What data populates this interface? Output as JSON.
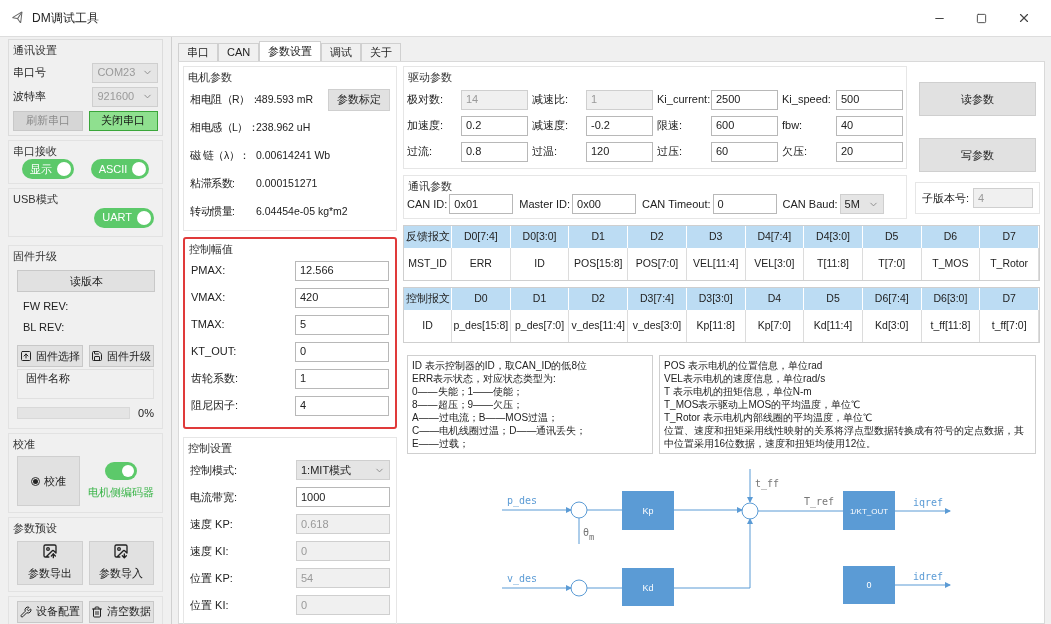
{
  "window": {
    "title": "DM调试工具"
  },
  "sidebar": {
    "comm": {
      "title": "通讯设置",
      "port_label": "串口号",
      "port": {
        "value": "COM23",
        "disabled": true
      },
      "baud_label": "波特率",
      "baud": {
        "value": "921600",
        "disabled": true
      },
      "buttons": [
        {
          "label": "刷新串口",
          "disabled": true,
          "active": false
        },
        {
          "label": "关闭串口",
          "disabled": false,
          "active": true
        }
      ]
    },
    "receive": {
      "title": "串口接收",
      "toggles": [
        {
          "label": "显示",
          "on": true
        },
        {
          "label": "ASCII",
          "on": true
        }
      ]
    },
    "usb": {
      "title": "USB模式",
      "toggles": [
        {
          "label": "UART",
          "on": true
        }
      ]
    },
    "firmware": {
      "title": "固件升级",
      "read_button": "读版本",
      "revisions": [
        "FW REV:",
        "BL REV:"
      ],
      "buttons": [
        {
          "label": "固件选择",
          "kind": "upload"
        },
        {
          "label": "固件升级",
          "kind": "save"
        }
      ],
      "name_label": "固件名称",
      "progress": {
        "level": 0,
        "reading": "0%"
      }
    },
    "calibrate": {
      "title": "校准",
      "radio": {
        "label": "校准",
        "selected": true
      },
      "toggle": {
        "label": "电机侧编码器",
        "on": true
      }
    },
    "presets": {
      "title": "参数预设",
      "buttons": [
        {
          "label": "参数导出",
          "kind": "export"
        },
        {
          "label": "参数导入",
          "kind": "import"
        }
      ]
    },
    "footer_buttons": [
      {
        "label": "设备配置",
        "kind": "tools"
      },
      {
        "label": "清空数据",
        "kind": "trash"
      }
    ]
  },
  "tabs": [
    {
      "label": "串口",
      "selected": false
    },
    {
      "label": "CAN",
      "selected": false
    },
    {
      "label": "参数设置",
      "selected": true
    },
    {
      "label": "调试",
      "selected": false
    },
    {
      "label": "关于",
      "selected": false
    }
  ],
  "motor": {
    "title": "电机参数",
    "calibrate_button": "参数标定",
    "rows": [
      {
        "label": "相电阻（R）：",
        "value": "489.593 mR"
      },
      {
        "label": "相电感（L）：",
        "value": "238.962 uH"
      },
      {
        "label": "磁 链（λ）：",
        "value": "0.00614241 Wb"
      },
      {
        "label": "粘滞系数:",
        "value": "0.000151271"
      },
      {
        "label": "转动惯量:",
        "value": "6.04454e-05 kg*m2"
      }
    ]
  },
  "limits": {
    "title": "控制幅值",
    "highlighted": true,
    "rows": [
      {
        "label": "PMAX:",
        "value": "12.566"
      },
      {
        "label": "VMAX:",
        "value": "420"
      },
      {
        "label": "TMAX:",
        "value": "5"
      },
      {
        "label": "KT_OUT:",
        "value": "0"
      },
      {
        "label": "齿轮系数:",
        "value": "1"
      },
      {
        "label": "阻尼因子:",
        "value": "4"
      }
    ]
  },
  "control": {
    "title": "控制设置",
    "rows": [
      {
        "label": "控制模式:",
        "value": "1:MIT模式",
        "kind": "select",
        "disabled": false
      },
      {
        "label": "电流带宽:",
        "value": "1000",
        "kind": "input",
        "disabled": false
      },
      {
        "label": "速度 KP:",
        "value": "0.618",
        "kind": "input",
        "disabled": true
      },
      {
        "label": "速度 KI:",
        "value": "0",
        "kind": "input",
        "disabled": true
      },
      {
        "label": "位置 KP:",
        "value": "54",
        "kind": "input",
        "disabled": true
      },
      {
        "label": "位置 KI:",
        "value": "0",
        "kind": "input",
        "disabled": true
      }
    ]
  },
  "drive": {
    "title": "驱动参数",
    "fields": [
      {
        "label": "极对数:",
        "value": "14",
        "disabled": true
      },
      {
        "label": "减速比:",
        "value": "1",
        "disabled": true
      },
      {
        "label": "Ki_current:",
        "value": "2500",
        "disabled": false
      },
      {
        "label": "Ki_speed:",
        "value": "500",
        "disabled": false
      },
      {
        "label": "加速度:",
        "value": "0.2",
        "disabled": false
      },
      {
        "label": "减速度:",
        "value": "-0.2",
        "disabled": false
      },
      {
        "label": "限速:",
        "value": "600",
        "disabled": false
      },
      {
        "label": "fbw:",
        "value": "40",
        "disabled": false
      },
      {
        "label": "过流:",
        "value": "0.8",
        "disabled": false
      },
      {
        "label": "过温:",
        "value": "120",
        "disabled": false
      },
      {
        "label": "过压:",
        "value": "60",
        "disabled": false
      },
      {
        "label": "欠压:",
        "value": "20",
        "disabled": false
      }
    ]
  },
  "actions": [
    "读参数",
    "写参数"
  ],
  "comm_params": {
    "title": "通讯参数",
    "fields": [
      {
        "label": "CAN ID:",
        "value": "0x01",
        "kind": "input"
      },
      {
        "label": "Master ID:",
        "value": "0x00",
        "kind": "input"
      },
      {
        "label": "CAN Timeout:",
        "value": "0",
        "kind": "input"
      },
      {
        "label": "CAN Baud:",
        "value": "5M",
        "kind": "select"
      }
    ]
  },
  "sub_version": {
    "label": "子版本号:",
    "value": "4",
    "disabled": true
  },
  "tables": [
    {
      "header": [
        "反馈报文",
        "D0[7:4]",
        "D0[3:0]",
        "D1",
        "D2",
        "D3",
        "D4[7:4]",
        "D4[3:0]",
        "D5",
        "D6",
        "D7"
      ],
      "row": [
        "MST_ID",
        "ERR",
        "ID",
        "POS[15:8]",
        "POS[7:0]",
        "VEL[11:4]",
        "VEL[3:0]",
        "T[11:8]",
        "T[7:0]",
        "T_MOS",
        "T_Rotor"
      ]
    },
    {
      "header": [
        "控制报文",
        "D0",
        "D1",
        "D2",
        "D3[7:4]",
        "D3[3:0]",
        "D4",
        "D5",
        "D6[7:4]",
        "D6[3:0]",
        "D7"
      ],
      "row": [
        "ID",
        "p_des[15:8]",
        "p_des[7:0]",
        "v_des[11:4]",
        "v_des[3:0]",
        "Kp[11:8]",
        "Kp[7:0]",
        "Kd[11:4]",
        "Kd[3:0]",
        "t_ff[11:8]",
        "t_ff[7:0]"
      ]
    }
  ],
  "notes": [
    [
      "ID 表示控制器的ID，取CAN_ID的低8位",
      "ERR表示状态，对应状态类型为:",
      "0——失能；1——使能；",
      "8——超压；9——欠压；",
      "A——过电流；B——MOS过温；",
      "C——电机线圈过温；D——通讯丢失；",
      "E——过载；"
    ],
    [
      "POS 表示电机的位置信息，单位rad",
      "VEL表示电机的速度信息，单位rad/s",
      "T 表示电机的扭矩信息，单位N-m",
      "T_MOS表示驱动上MOS的平均温度，单位℃",
      "T_Rotor 表示电机内部线圈的平均温度，单位℃",
      "位置、速度和扭矩采用线性映射的关系将浮点型数据转换成有符号的定点数据，其中位置采用16位数据，速度和扭矩均使用12位。"
    ]
  ],
  "diagram": {
    "p_des": "p_des",
    "v_des": "v_des",
    "theta": "θ",
    "theta_sub": "m",
    "kp": "Kp",
    "kd": "Kd",
    "t_ff": "t_ff",
    "t_ref": "T_ref",
    "kt": "1/KT_OUT",
    "iqref": "iqref",
    "zero": "0",
    "idref": "idref"
  }
}
